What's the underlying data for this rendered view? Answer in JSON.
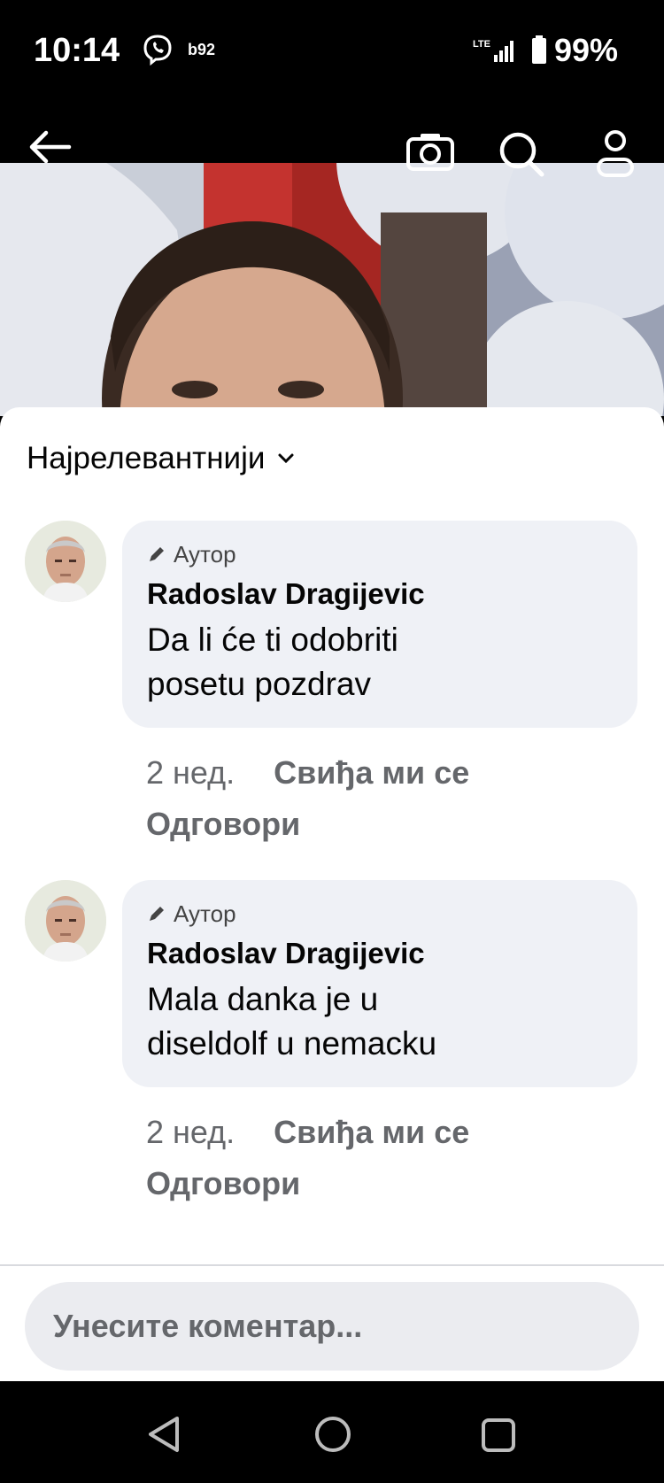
{
  "status_bar": {
    "time": "10:14",
    "carrier": "b92",
    "network": "LTE",
    "battery": "99%",
    "icons": [
      "viber-icon",
      "lte-signal-icon",
      "battery-icon"
    ]
  },
  "top_bar": {
    "icons": [
      "back-arrow-icon",
      "camera-icon",
      "search-icon",
      "profile-icon"
    ]
  },
  "sort": {
    "label": "Најрелевантнији",
    "icon": "chevron-down-icon"
  },
  "comments": [
    {
      "badge": "Аутор",
      "name": "Radoslav Dragijevic",
      "text_lines": [
        "Da li će ti odobriti",
        "posetu pozdrav"
      ],
      "time": "2 нед.",
      "like": "Свиђа ми се",
      "reply": "Одговори"
    },
    {
      "badge": "Аутор",
      "name": "Radoslav Dragijevic",
      "text_lines": [
        "Mala danka je u",
        "diseldolf u nemacku"
      ],
      "time": "2 нед.",
      "like": "Свиђа ми се",
      "reply": "Одговори"
    }
  ],
  "composer": {
    "placeholder": "Унесите коментар..."
  },
  "nav_bar": {
    "icons": [
      "back-triangle-icon",
      "home-circle-icon",
      "recents-square-icon"
    ]
  },
  "colors": {
    "sheet_bg": "#ffffff",
    "bubble_bg": "#eff1f6",
    "meta_text": "#65676b",
    "input_bg": "#ebecf0"
  }
}
